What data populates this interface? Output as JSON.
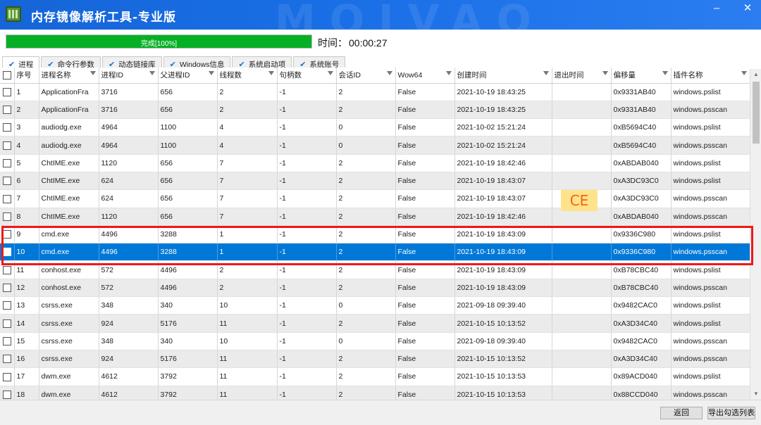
{
  "app": {
    "title": "内存镜像解析工具-专业版",
    "watermark": "MOIVAO",
    "window_buttons": {
      "minimize": "–",
      "close": "✕"
    }
  },
  "progress": {
    "text": "完成[100%]",
    "percent": 100,
    "color": "#06b025"
  },
  "timer": {
    "label": "时间：",
    "value": "00:00:27"
  },
  "tabs": [
    {
      "label": "进程",
      "active": true
    },
    {
      "label": "命令行参数",
      "active": false
    },
    {
      "label": "动态链接库",
      "active": false
    },
    {
      "label": "Windows信息",
      "active": false
    },
    {
      "label": "系统启动项",
      "active": false
    },
    {
      "label": "系统账号",
      "active": false
    }
  ],
  "columns": [
    "序号",
    "进程名称",
    "进程ID",
    "父进程ID",
    "线程数",
    "句柄数",
    "会话ID",
    "Wow64",
    "创建时间",
    "退出时间",
    "偏移量",
    "插件名称"
  ],
  "rows": [
    [
      "1",
      "ApplicationFra",
      "3716",
      "656",
      "2",
      "-1",
      "2",
      "False",
      "2021-10-19 18:43:25",
      "",
      "0x9331AB40",
      "windows.pslist"
    ],
    [
      "2",
      "ApplicationFra",
      "3716",
      "656",
      "2",
      "-1",
      "2",
      "False",
      "2021-10-19 18:43:25",
      "",
      "0x9331AB40",
      "windows.psscan"
    ],
    [
      "3",
      "audiodg.exe",
      "4964",
      "1100",
      "4",
      "-1",
      "0",
      "False",
      "2021-10-02 15:21:24",
      "",
      "0xB5694C40",
      "windows.pslist"
    ],
    [
      "4",
      "audiodg.exe",
      "4964",
      "1100",
      "4",
      "-1",
      "0",
      "False",
      "2021-10-02 15:21:24",
      "",
      "0xB5694C40",
      "windows.psscan"
    ],
    [
      "5",
      "ChtIME.exe",
      "1120",
      "656",
      "7",
      "-1",
      "2",
      "False",
      "2021-10-19 18:42:46",
      "",
      "0xABDAB040",
      "windows.pslist"
    ],
    [
      "6",
      "ChtIME.exe",
      "624",
      "656",
      "7",
      "-1",
      "2",
      "False",
      "2021-10-19 18:43:07",
      "",
      "0xA3DC93C0",
      "windows.pslist"
    ],
    [
      "7",
      "ChtIME.exe",
      "624",
      "656",
      "7",
      "-1",
      "2",
      "False",
      "2021-10-19 18:43:07",
      "",
      "0xA3DC93C0",
      "windows.psscan"
    ],
    [
      "8",
      "ChtIME.exe",
      "1120",
      "656",
      "7",
      "-1",
      "2",
      "False",
      "2021-10-19 18:42:46",
      "",
      "0xABDAB040",
      "windows.psscan"
    ],
    [
      "9",
      "cmd.exe",
      "4496",
      "3288",
      "1",
      "-1",
      "2",
      "False",
      "2021-10-19 18:43:09",
      "",
      "0x9336C980",
      "windows.pslist"
    ],
    [
      "10",
      "cmd.exe",
      "4496",
      "3288",
      "1",
      "-1",
      "2",
      "False",
      "2021-10-19 18:43:09",
      "",
      "0x9336C980",
      "windows.psscan"
    ],
    [
      "11",
      "conhost.exe",
      "572",
      "4496",
      "2",
      "-1",
      "2",
      "False",
      "2021-10-19 18:43:09",
      "",
      "0xB78CBC40",
      "windows.pslist"
    ],
    [
      "12",
      "conhost.exe",
      "572",
      "4496",
      "2",
      "-1",
      "2",
      "False",
      "2021-10-19 18:43:09",
      "",
      "0xB78CBC40",
      "windows.psscan"
    ],
    [
      "13",
      "csrss.exe",
      "348",
      "340",
      "10",
      "-1",
      "0",
      "False",
      "2021-09-18 09:39:40",
      "",
      "0x9482CAC0",
      "windows.pslist"
    ],
    [
      "14",
      "csrss.exe",
      "924",
      "5176",
      "11",
      "-1",
      "2",
      "False",
      "2021-10-15 10:13:52",
      "",
      "0xA3D34C40",
      "windows.pslist"
    ],
    [
      "15",
      "csrss.exe",
      "348",
      "340",
      "10",
      "-1",
      "0",
      "False",
      "2021-09-18 09:39:40",
      "",
      "0x9482CAC0",
      "windows.psscan"
    ],
    [
      "16",
      "csrss.exe",
      "924",
      "5176",
      "11",
      "-1",
      "2",
      "False",
      "2021-10-15 10:13:52",
      "",
      "0xA3D34C40",
      "windows.psscan"
    ],
    [
      "17",
      "dwm.exe",
      "4612",
      "3792",
      "11",
      "-1",
      "2",
      "False",
      "2021-10-15 10:13:53",
      "",
      "0x89ACD040",
      "windows.pslist"
    ],
    [
      "18",
      "dwm.exe",
      "4612",
      "3792",
      "11",
      "-1",
      "2",
      "False",
      "2021-10-15 10:13:53",
      "",
      "0x88CCD040",
      "windows.psscan"
    ]
  ],
  "selected_row": 10,
  "highlight_rows": [
    9,
    10
  ],
  "annotation": {
    "text": "CE"
  },
  "buttons": {
    "back": "返回",
    "export": "导出勾选列表"
  },
  "colors": {
    "titlebar": "#1a6fe6",
    "selection": "#0078d7",
    "highlight": "#f01818",
    "tab_check": "#1f6fd0"
  }
}
